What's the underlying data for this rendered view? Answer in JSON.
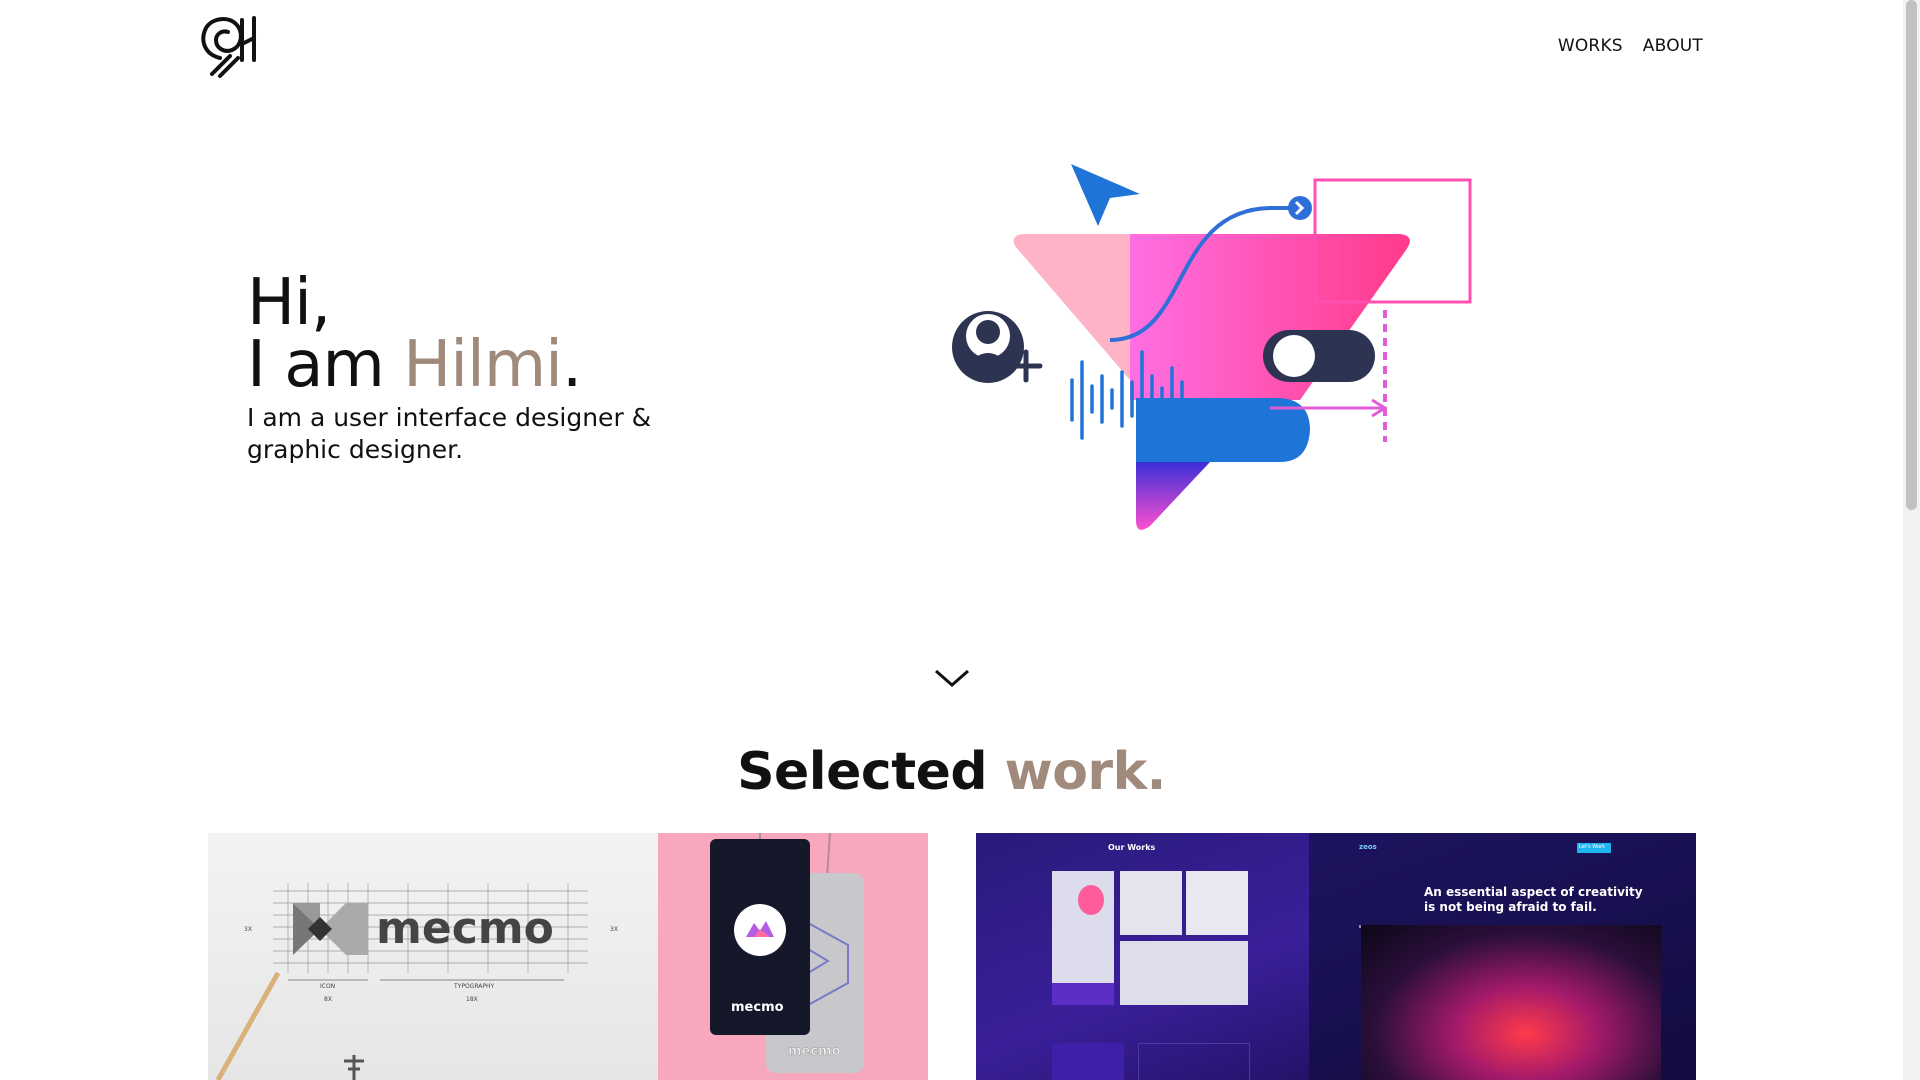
{
  "nav": {
    "works": "WORKS",
    "about": "ABOUT"
  },
  "hero": {
    "greeting": "Hi,",
    "intro_prefix": "I am ",
    "name": "Hilmi",
    "intro_suffix": ".",
    "subtitle": "I am a user interface designer & graphic designer."
  },
  "section": {
    "title_prefix": "Selected ",
    "title_accent": "work."
  },
  "work1": {
    "brand": "mecmo",
    "icon_label": "ICON",
    "typography_label": "TYPOGRAPHY",
    "icon_size": "8X",
    "typo_size": "18X",
    "side_size": "3X"
  },
  "work2": {
    "heading": "Our Works",
    "tagline_1": "An essential aspect of creativity",
    "tagline_2": "is not being afraid to fail.",
    "nav_logo": "zeos",
    "cta": "Let's Work"
  },
  "colors": {
    "accent": "#a08a7b",
    "pink": "#ff4fb0",
    "blue": "#1f74d8",
    "navy": "#2d3451"
  },
  "icons": [
    "logo-mark",
    "cursor-arrow",
    "user-add-icon",
    "toggle-switch",
    "chevron-down-icon"
  ]
}
